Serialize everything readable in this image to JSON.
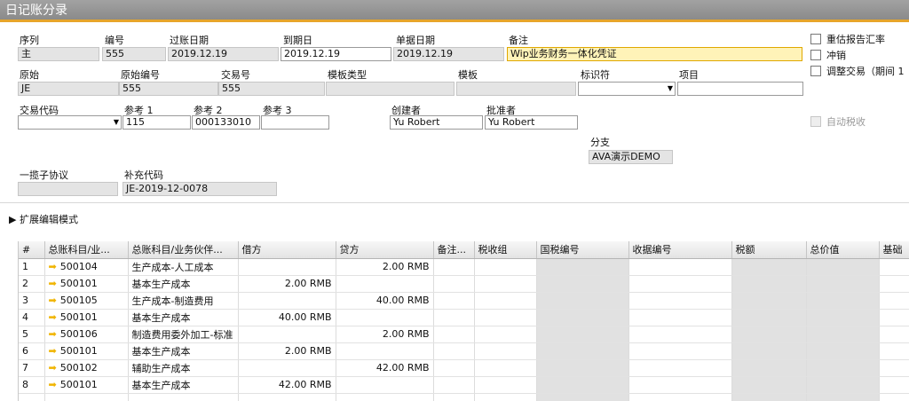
{
  "window": {
    "title": "日记账分录"
  },
  "header": {
    "seq_label": "序列",
    "seq_value": "主",
    "number_label": "编号",
    "number_value": "555",
    "posting_date_label": "过账日期",
    "posting_date_value": "2019.12.19",
    "due_date_label": "到期日",
    "due_date_value": "2019.12.19",
    "doc_date_label": "单据日期",
    "doc_date_value": "2019.12.19",
    "remarks_label": "备注",
    "remarks_value": "Wip业务财务一体化凭证",
    "origin_label": "原始",
    "origin_value": "JE",
    "origin_no_label": "原始编号",
    "origin_no_value": "555",
    "trans_no_label": "交易号",
    "trans_no_value": "555",
    "template_type_label": "模板类型",
    "template_label": "模板",
    "indicator_label": "标识符",
    "project_label": "项目",
    "trans_code_label": "交易代码",
    "ref1_label": "参考 1",
    "ref1_value": "115",
    "ref2_label": "参考 2",
    "ref2_value": "000133010",
    "ref3_label": "参考 3",
    "creator_label": "创建者",
    "creator_value": "Yu Robert",
    "approver_label": "批准者",
    "approver_value": "Yu Robert",
    "branch_label": "分支",
    "branch_value": "AVA演示DEMO",
    "blanket_label": "一揽子协议",
    "supp_code_label": "补充代码",
    "supp_code_value": "JE-2019-12-0078"
  },
  "checks": {
    "revalue": "重估报告汇率",
    "reverse": "冲销",
    "adjust": "调整交易（期间 1",
    "auto_tax": "自动税收"
  },
  "expand_mode": "扩展编辑模式",
  "table": {
    "columns": [
      "#",
      "总账科目/业...",
      "总账科目/业务伙伴...",
      "借方",
      "贷方",
      "备注...",
      "税收组",
      "国税编号",
      "收据编号",
      "税额",
      "总价值",
      "基础"
    ],
    "rows": [
      {
        "no": "1",
        "account": "500104",
        "name": "生产成本-人工成本",
        "debit": "",
        "credit": "2.00 RMB"
      },
      {
        "no": "2",
        "account": "500101",
        "name": "基本生产成本",
        "debit": "2.00 RMB",
        "credit": ""
      },
      {
        "no": "3",
        "account": "500105",
        "name": "生产成本-制造费用",
        "debit": "",
        "credit": "40.00 RMB"
      },
      {
        "no": "4",
        "account": "500101",
        "name": "基本生产成本",
        "debit": "40.00 RMB",
        "credit": ""
      },
      {
        "no": "5",
        "account": "500106",
        "name": "制造费用委外加工-标准",
        "debit": "",
        "credit": "2.00 RMB"
      },
      {
        "no": "6",
        "account": "500101",
        "name": "基本生产成本",
        "debit": "2.00 RMB",
        "credit": ""
      },
      {
        "no": "7",
        "account": "500102",
        "name": "辅助生产成本",
        "debit": "",
        "credit": "42.00 RMB"
      },
      {
        "no": "8",
        "account": "500101",
        "name": "基本生产成本",
        "debit": "42.00 RMB",
        "credit": ""
      }
    ]
  }
}
